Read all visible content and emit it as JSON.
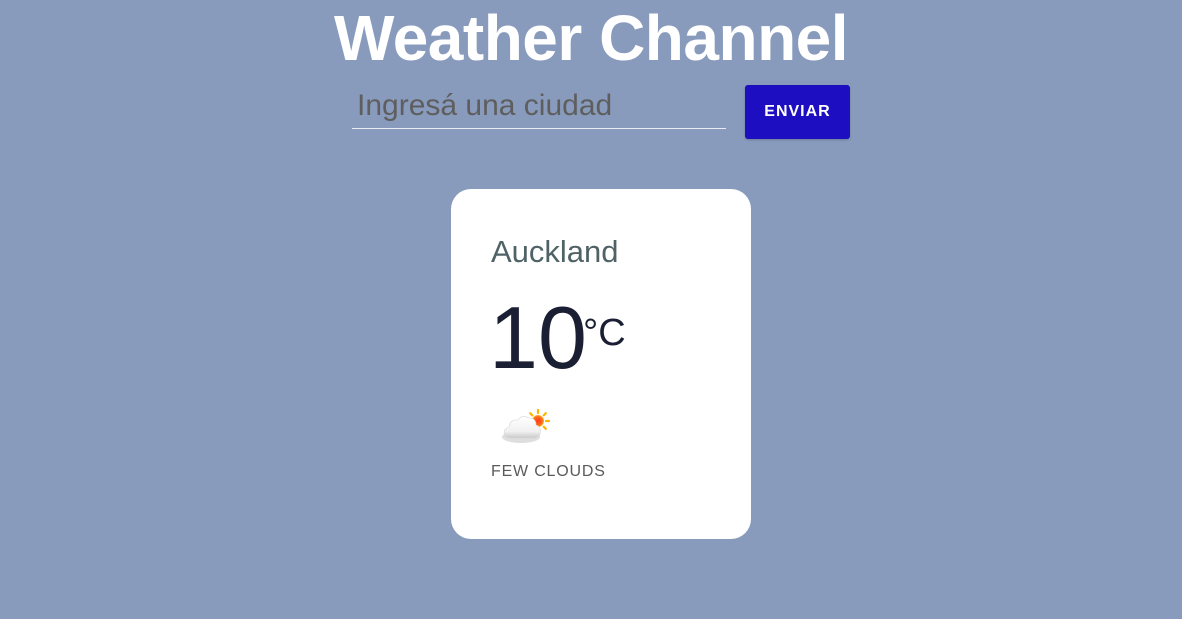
{
  "header": {
    "title": "Weather Channel"
  },
  "search": {
    "placeholder": "Ingresá una ciudad",
    "value": "",
    "submit_label": "ENVIAR"
  },
  "weather": {
    "city": "Auckland",
    "temperature": "10",
    "unit": "°C",
    "icon": "few-clouds-icon",
    "description": "FEW CLOUDS"
  },
  "colors": {
    "background": "#889bbd",
    "button": "#1e0ec2",
    "card": "#ffffff"
  }
}
